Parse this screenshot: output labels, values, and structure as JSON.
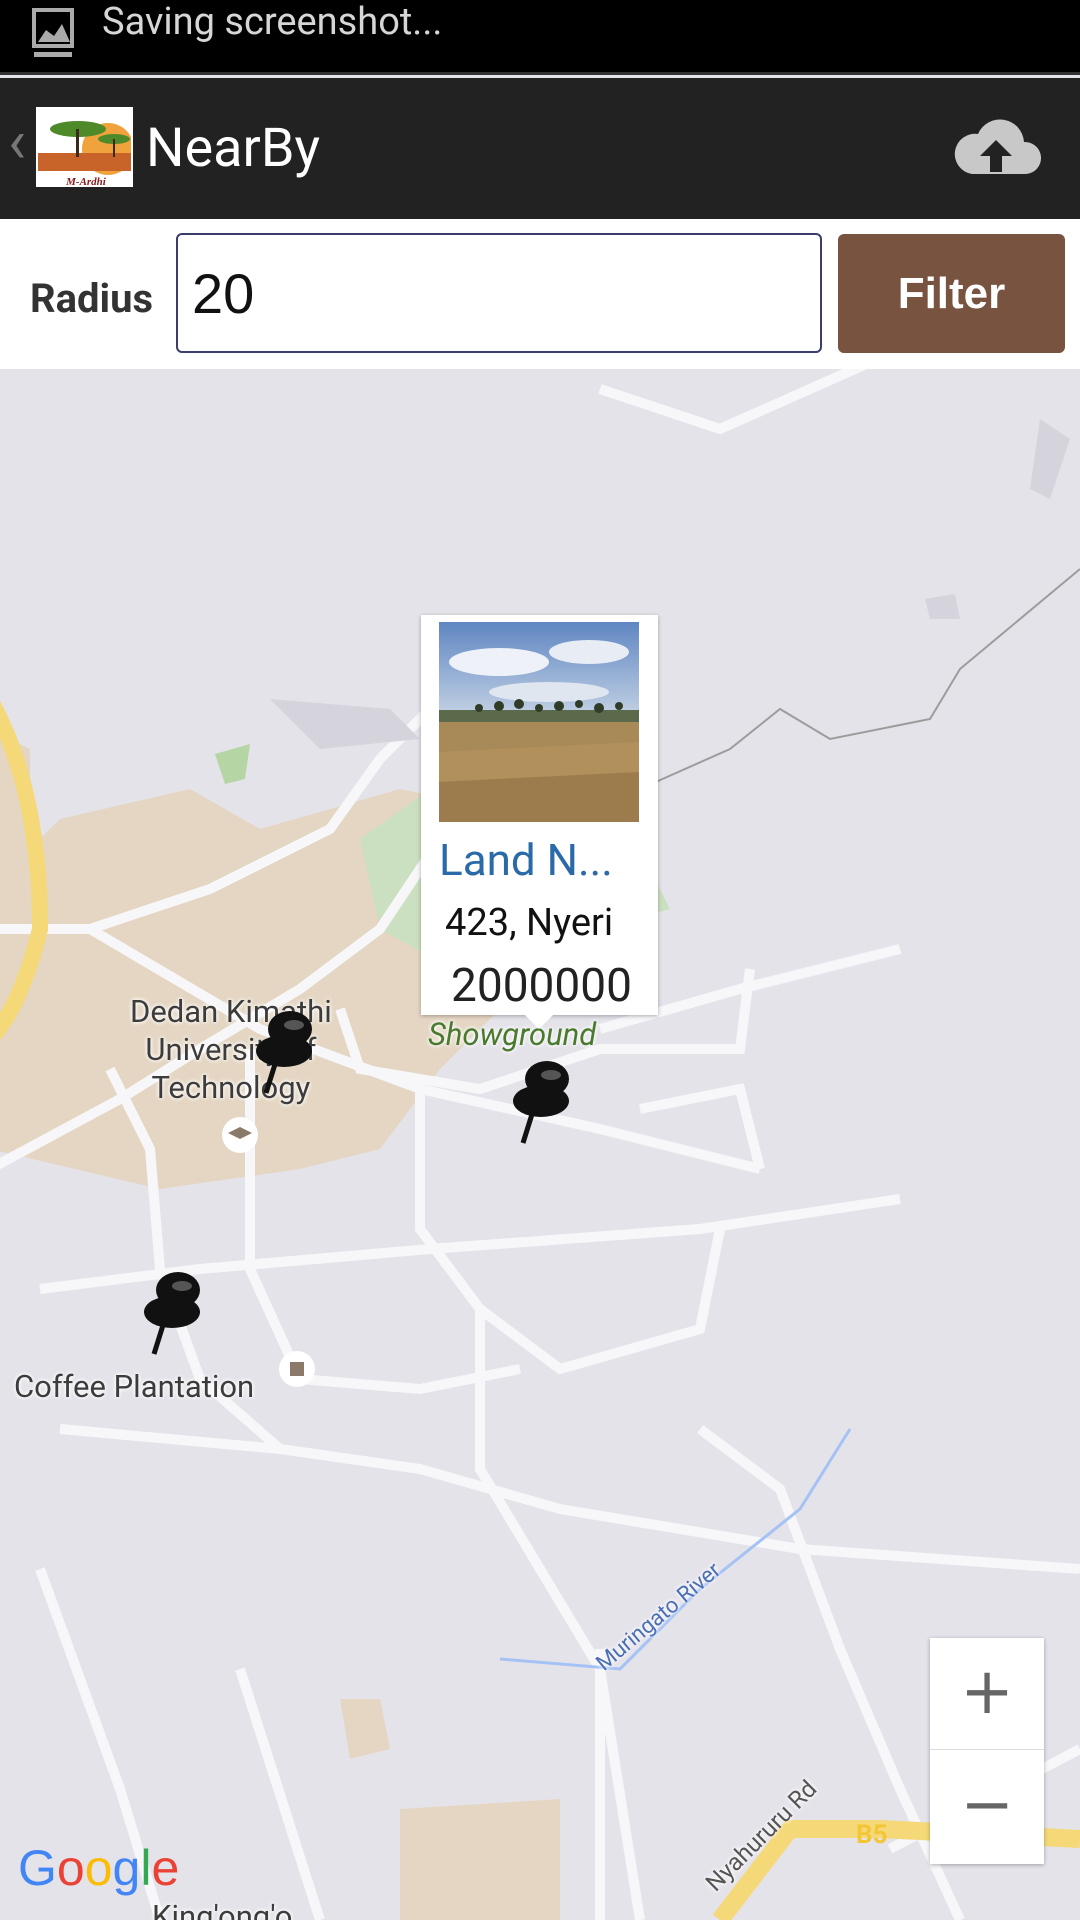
{
  "status_bar": {
    "text": "Saving screenshot..."
  },
  "app_bar": {
    "title": "NearBy",
    "logo_text": "M-Ardhi",
    "back_icon": "chevron-left-icon",
    "action_icon": "cloud-upload-icon"
  },
  "filter": {
    "label": "Radius",
    "value": "20",
    "button": "Filter"
  },
  "map": {
    "labels": {
      "university_line1": "Dedan Kimathi",
      "university_line2": "University of",
      "university_line3": "Technology",
      "showground": "Showground",
      "coffee": "Coffee Plantation",
      "river": "Muringato River",
      "road": "Nyahururu Rd",
      "road_badge": "B5",
      "town": "King'ong'o"
    },
    "google_logo": "Google"
  },
  "info_window": {
    "name": "Land N...",
    "address": "423, Nyeri",
    "price": "2000000"
  },
  "zoom": {
    "in": "+",
    "out": "−"
  }
}
